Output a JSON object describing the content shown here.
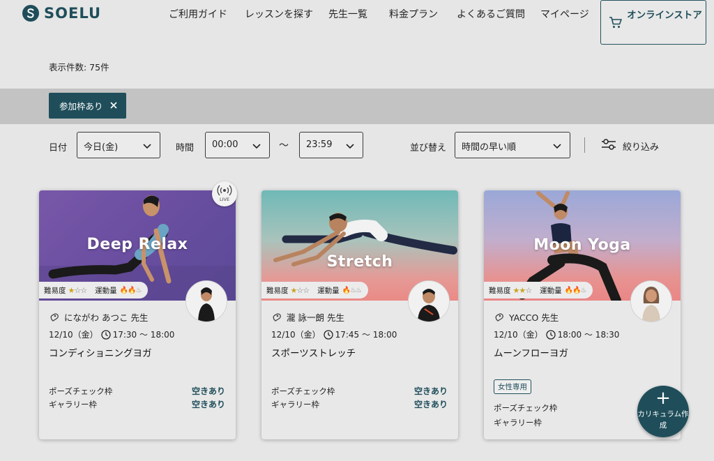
{
  "header": {
    "logo": "SOELU",
    "nav": [
      "ご利用ガイド",
      "レッスンを探す",
      "先生一覧",
      "料金プラン",
      "よくあるご質問",
      "マイページ"
    ],
    "store_button": "オンラインストア",
    "cart_icon": "cart-icon"
  },
  "results": {
    "count_label": "表示件数: 75件"
  },
  "active_filter": {
    "label": "参加枠あり",
    "remove_icon": "close-icon"
  },
  "filters": {
    "date_label": "日付",
    "date_value": "今日(金)",
    "time_label": "時間",
    "time_from": "00:00",
    "time_sep": "〜",
    "time_to": "23:59",
    "sort_label": "並び替え",
    "sort_value": "時間の早い順",
    "narrow_label": "絞り込み"
  },
  "colors": {
    "accent": "#1f4e5a",
    "background": "#e6e6e6",
    "band": "#c3c3c3",
    "star": "#c9a320",
    "flame": "#d44a2a"
  },
  "cards": [
    {
      "banner_title": "Deep Relax",
      "live": true,
      "live_label": "LIVE",
      "difficulty_label": "難易度",
      "difficulty": 1,
      "exercise_label": "運動量",
      "exercise": 2,
      "teacher": "にながわ あつこ 先生",
      "date": "12/10（金）",
      "time": "17:30 〜 18:00",
      "lesson": "コンディショニングヨガ",
      "tag": "",
      "pose_label": "ポーズチェック枠",
      "pose_status": "空きあり",
      "gallery_label": "ギャラリー枠",
      "gallery_status": "空きあり"
    },
    {
      "banner_title": "Stretch",
      "live": false,
      "difficulty_label": "難易度",
      "difficulty": 1,
      "exercise_label": "運動量",
      "exercise": 1,
      "teacher": "瀧 詠一朗 先生",
      "date": "12/10（金）",
      "time": "17:45 〜 18:00",
      "lesson": "スポーツストレッチ",
      "tag": "",
      "pose_label": "ポーズチェック枠",
      "pose_status": "空きあり",
      "gallery_label": "ギャラリー枠",
      "gallery_status": "空きあり"
    },
    {
      "banner_title": "Moon Yoga",
      "live": false,
      "difficulty_label": "難易度",
      "difficulty": 2,
      "exercise_label": "運動量",
      "exercise": 2,
      "teacher": "YACCO 先生",
      "date": "12/10（金）",
      "time": "18:00 〜 18:30",
      "lesson": "ムーンフローヨガ",
      "tag": "女性専用",
      "pose_label": "ポーズチェック枠",
      "pose_status": "",
      "gallery_label": "ギャラリー枠",
      "gallery_status": ""
    }
  ],
  "fab": {
    "label": "カリキュラム作成",
    "icon": "plus-icon"
  }
}
